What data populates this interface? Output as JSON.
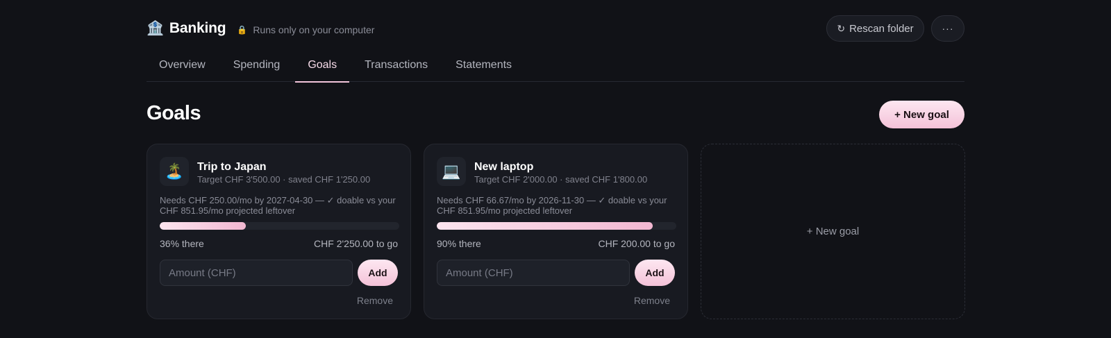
{
  "app": {
    "icon": "bank-emoji",
    "icon_glyph": "🏦",
    "title": "Banking",
    "local_note": "Runs only on your computer",
    "lock_glyph": "🔒"
  },
  "header": {
    "rescan_label": "Rescan folder",
    "more_label": "···"
  },
  "tabs": [
    {
      "label": "Overview",
      "active": false
    },
    {
      "label": "Spending",
      "active": false
    },
    {
      "label": "Goals",
      "active": true
    },
    {
      "label": "Transactions",
      "active": false
    },
    {
      "label": "Statements",
      "active": false
    }
  ],
  "page": {
    "title": "Goals",
    "new_goal_label": "+ New goal"
  },
  "goals": [
    {
      "emoji": "🏝️",
      "name": "Trip to Japan",
      "subtitle": "Target CHF 3'500.00 · saved CHF 1'250.00",
      "needs": "Needs CHF 250.00/mo by 2027-04-30 — ✓ doable vs your CHF 851.95/mo projected leftover",
      "progress_percent": 36,
      "progress_label": "36% there",
      "to_go": "CHF 2'250.00 to go",
      "amount_placeholder": "Amount (CHF)",
      "add_label": "Add",
      "remove_label": "Remove"
    },
    {
      "emoji": "💻",
      "name": "New laptop",
      "subtitle": "Target CHF 2'000.00 · saved CHF 1'800.00",
      "needs": "Needs CHF 66.67/mo by 2026-11-30 — ✓ doable vs your CHF 851.95/mo projected leftover",
      "progress_percent": 90,
      "progress_label": "90% there",
      "to_go": "CHF 200.00 to go",
      "amount_placeholder": "Amount (CHF)",
      "add_label": "Add",
      "remove_label": "Remove"
    }
  ],
  "new_goal_card_label": "+ New goal",
  "colors": {
    "background": "#111217",
    "card": "#181a21",
    "accent": "#f4c2d8"
  }
}
